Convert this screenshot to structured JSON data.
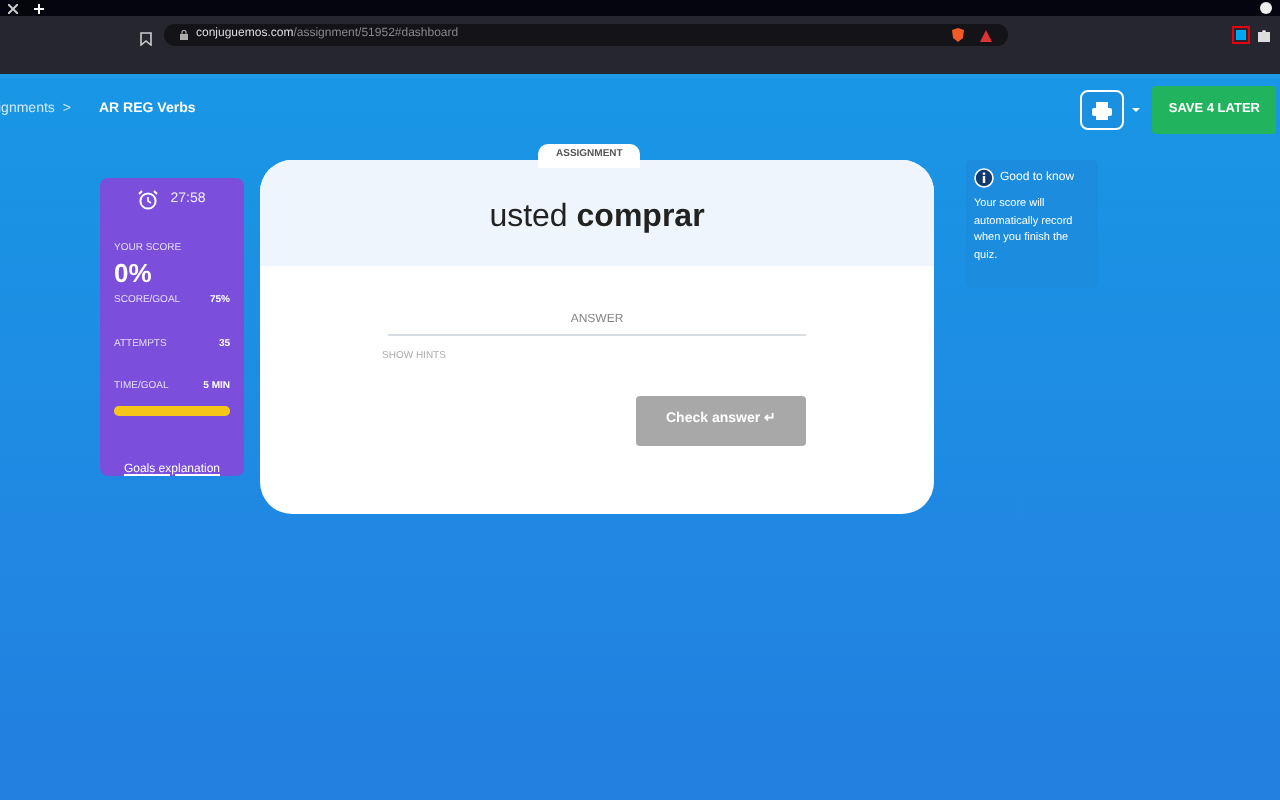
{
  "browser": {
    "url_domain": "conjuguemos.com",
    "url_path": "/assignment/51952#dashboard"
  },
  "breadcrumb": {
    "parent": "ignments",
    "separator": ">",
    "current": "AR REG Verbs"
  },
  "header": {
    "save_button": "SAVE 4 LATER"
  },
  "stats": {
    "timer": "27:58",
    "score_label": "YOUR SCORE",
    "score": "0%",
    "rows": [
      {
        "label": "SCORE/GOAL",
        "value": "75%"
      },
      {
        "label": "ATTEMPTS",
        "value": "35"
      },
      {
        "label": "TIME/GOAL",
        "value": "5 MIN"
      }
    ],
    "time_progress": {
      "level": 1
    },
    "link": "Goals explanation"
  },
  "card": {
    "tab": "ASSIGNMENT",
    "pronoun": "usted",
    "verb": "comprar",
    "placeholder": "ANSWER",
    "hints": "SHOW HINTS",
    "check_button": "Check answer",
    "check_icon": "↵"
  },
  "info": {
    "title": "Good to know",
    "text": "Your score will automatically record when you finish the quiz."
  }
}
